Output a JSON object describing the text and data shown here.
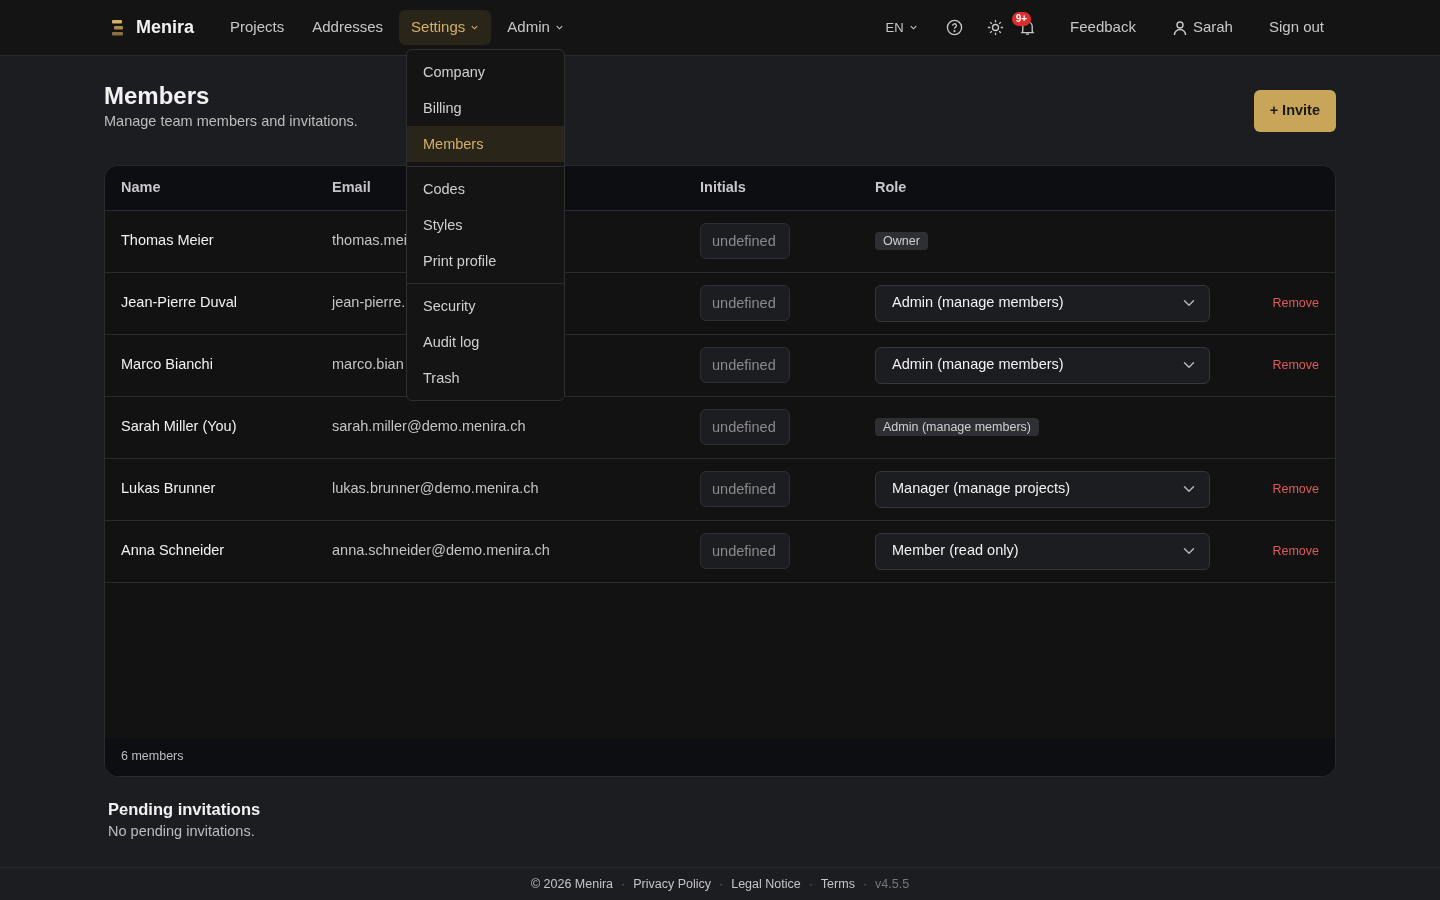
{
  "navbar": {
    "brand": "Menira",
    "links": [
      {
        "label": "Projects",
        "selected": false,
        "dropdown": false
      },
      {
        "label": "Addresses",
        "selected": false,
        "dropdown": false
      },
      {
        "label": "Settings",
        "selected": true,
        "dropdown": true
      },
      {
        "label": "Admin",
        "selected": false,
        "dropdown": true
      }
    ],
    "language": "EN",
    "notification_badge": "9+",
    "feedback": "Feedback",
    "user": "Sarah",
    "sign_out": "Sign out"
  },
  "settings_menu": [
    [
      {
        "label": "Company",
        "selected": false
      },
      {
        "label": "Billing",
        "selected": false
      },
      {
        "label": "Members",
        "selected": true
      }
    ],
    [
      {
        "label": "Codes",
        "selected": false
      },
      {
        "label": "Styles",
        "selected": false
      },
      {
        "label": "Print profile",
        "selected": false
      }
    ],
    [
      {
        "label": "Security",
        "selected": false
      },
      {
        "label": "Audit log",
        "selected": false
      },
      {
        "label": "Trash",
        "selected": false
      }
    ]
  ],
  "page": {
    "title": "Members",
    "subtitle": "Manage team members and invitations.",
    "invite_button": "+ Invite"
  },
  "table": {
    "columns": [
      "Name",
      "Email",
      "Initials",
      "Role"
    ],
    "rows": [
      {
        "name": "Thomas Meier",
        "email": "thomas.mei",
        "initials": "undefined",
        "role": {
          "kind": "badge",
          "label": "Owner"
        }
      },
      {
        "name": "Jean-Pierre Duval",
        "email": "jean-pierre.",
        "initials": "undefined",
        "role": {
          "kind": "select",
          "label": "Admin (manage members)"
        },
        "action": "Remove"
      },
      {
        "name": "Marco Bianchi",
        "email": "marco.bian",
        "initials": "undefined",
        "role": {
          "kind": "select",
          "label": "Admin (manage members)"
        },
        "action": "Remove"
      },
      {
        "name": "Sarah Miller (You)",
        "email": "sarah.miller@demo.menira.ch",
        "initials": "undefined",
        "role": {
          "kind": "badge",
          "label": "Admin (manage members)"
        }
      },
      {
        "name": "Lukas Brunner",
        "email": "lukas.brunner@demo.menira.ch",
        "initials": "undefined",
        "role": {
          "kind": "select",
          "label": "Manager (manage projects)"
        },
        "action": "Remove"
      },
      {
        "name": "Anna Schneider",
        "email": "anna.schneider@demo.menira.ch",
        "initials": "undefined",
        "role": {
          "kind": "select",
          "label": "Member (read only)"
        },
        "action": "Remove"
      }
    ],
    "footer": "6 members"
  },
  "pending": {
    "title": "Pending invitations",
    "text": "No pending invitations."
  },
  "footer": {
    "links": [
      "© 2026 Menira",
      "Privacy Policy",
      "Legal Notice",
      "Terms"
    ],
    "separator": "·",
    "version": "v4.5.5"
  }
}
